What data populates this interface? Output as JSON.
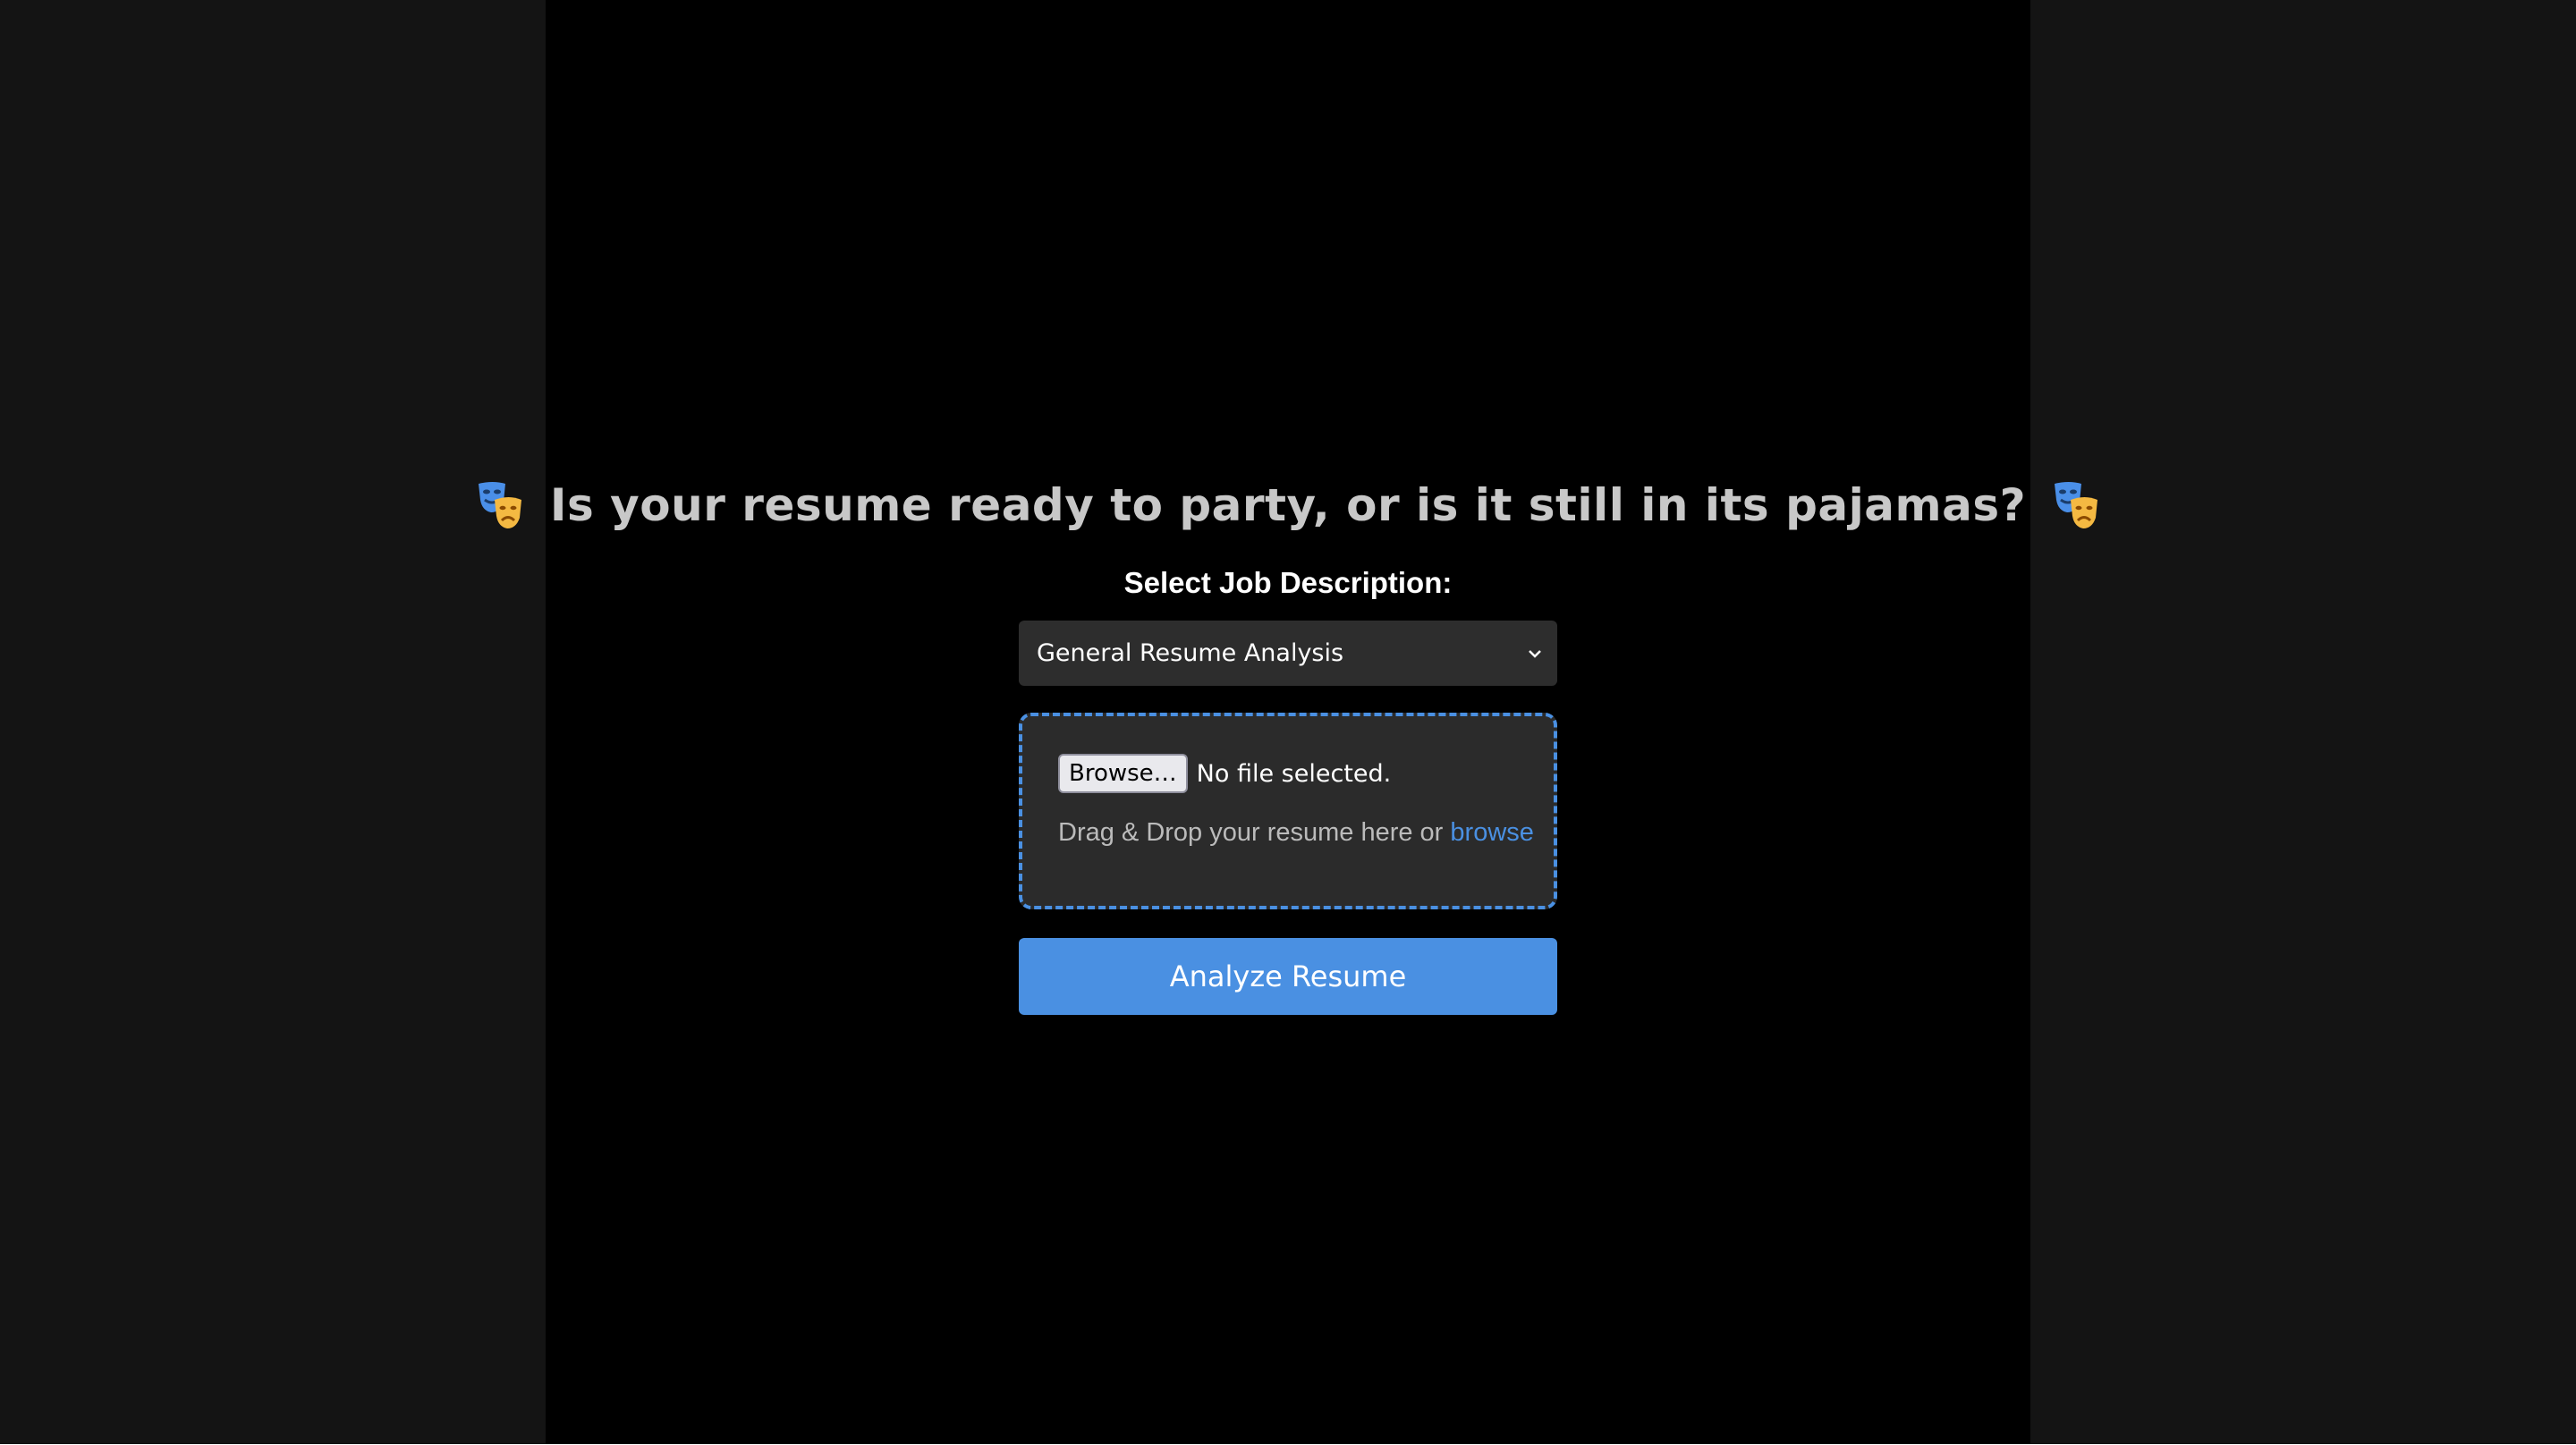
{
  "header": {
    "title": "Is your resume ready to party, or is it still in its pajamas?",
    "left_icon": "performing-arts-masks-icon",
    "right_icon": "performing-arts-masks-icon"
  },
  "form": {
    "job_label": "Select Job Description:",
    "job_select_value": "General Resume Analysis",
    "file_button_label": "Browse…",
    "file_status": "No file selected.",
    "drop_text": "Drag & Drop your resume here or",
    "drop_link": "browse",
    "analyze_label": "Analyze Resume"
  },
  "colors": {
    "accent": "#4a90e2",
    "page_background": "#141414",
    "panel_background": "#000000",
    "input_background": "#2d2d2d"
  }
}
